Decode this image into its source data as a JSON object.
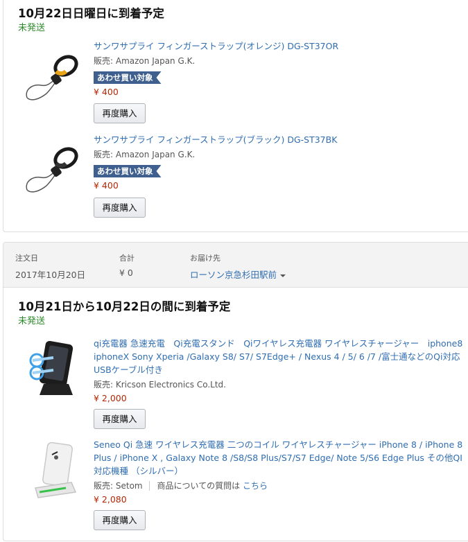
{
  "shipment1": {
    "heading": "10月22日日曜日に到着予定",
    "status": "未発送",
    "items": [
      {
        "title": "サンワサプライ フィンガーストラップ(オレンジ) DG-ST37OR",
        "seller_label": "販売:",
        "seller": "Amazon Japan G.K.",
        "badge": "あわせ買い対象",
        "price": "¥ 400",
        "rebuy": "再度購入",
        "image_icon": "finger-strap-orange",
        "accent": "#e8a317"
      },
      {
        "title": "サンワサプライ フィンガーストラップ(ブラック) DG-ST37BK",
        "seller_label": "販売:",
        "seller": "Amazon Japan G.K.",
        "badge": "あわせ買い対象",
        "price": "¥ 400",
        "rebuy": "再度購入",
        "image_icon": "finger-strap-black",
        "accent": "#222222"
      }
    ]
  },
  "order": {
    "date_label": "注文日",
    "date": "2017年10月20日",
    "total_label": "合計",
    "total": "¥ 0",
    "ship_to_label": "お届け先",
    "ship_to": "ローソン京急杉田駅前"
  },
  "shipment2": {
    "heading": "10月21日から10月22日の間に到着予定",
    "status": "未発送",
    "items": [
      {
        "title": "qi充電器 急速充電　Qi充電スタンド　Qiワイヤレス充電器 ワイヤレスチャージャー　iphone8　iphoneX Sony Xperia /Galaxy S8/ S7/ S7Edge+ / Nexus 4 / 5/ 6 /7 /富士通などのQi対応　USBケーブル付き",
        "seller_label": "販売:",
        "seller": "Kricson Electronics Co.Ltd.",
        "price": "¥ 2,000",
        "rebuy": "再度購入",
        "image_icon": "wireless-charger-black"
      },
      {
        "title": "Seneo Qi 急速 ワイヤレス充電器 二つのコイル ワイヤレスチャージャー iPhone 8 / iPhone 8 Plus / iPhone X , Galaxy Note 8 /S8/S8 Plus/S7/S7 Edge/ Note 5/S6 Edge Plus その他QI対応機種 （シルバー）",
        "seller_label": "販売:",
        "seller": "Setom",
        "question_text": "商品についての質問は",
        "question_link": "こちら",
        "price": "¥ 2,080",
        "rebuy": "再度購入",
        "image_icon": "wireless-charger-white"
      }
    ]
  },
  "colors": {
    "link": "#2f6db1",
    "price": "#b12704",
    "status_green": "#2d8a2b",
    "badge_blue": "#3f5f8f"
  }
}
